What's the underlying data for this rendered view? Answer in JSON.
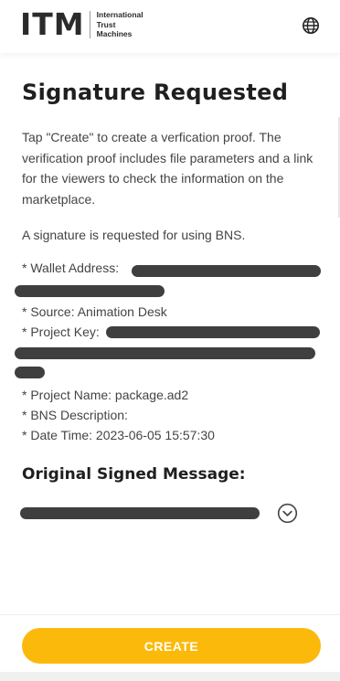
{
  "header": {
    "logo_mark": "ITM",
    "logo_lines": [
      "International",
      "Trust",
      "Machines"
    ],
    "language_icon": "globe-icon"
  },
  "title": "Signature Requested",
  "intro": "Tap \"Create\" to create a verfication proof. The verification proof includes file parameters and a link for the viewers to check the information on the marketplace.",
  "request_note": "A signature is requested for using BNS.",
  "details": {
    "wallet_address_label": "* Wallet Address:",
    "source": "* Source: Animation Desk",
    "project_key_label": "* Project Key:",
    "project_name": "* Project Name: package.ad2",
    "bns_description": "* BNS Description:",
    "date_time": "* Date Time: 2023-06-05 15:57:30"
  },
  "signed_message": {
    "heading": "Original Signed Message:",
    "expand_icon": "chevron-down-circle-icon"
  },
  "footer": {
    "create_label": "CREATE",
    "accent_color": "#fbb90b"
  }
}
